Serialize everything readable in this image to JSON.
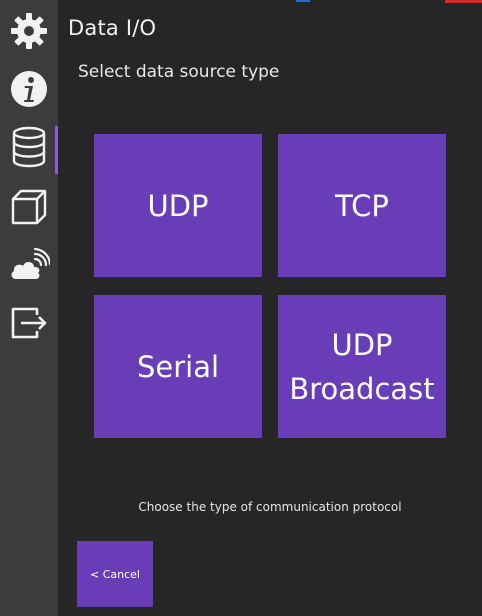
{
  "page": {
    "title": "Data I/O",
    "subtitle": "Select data source type",
    "hint": "Choose the type of communication protocol"
  },
  "sidebar": {
    "items": [
      {
        "icon": "gear-icon",
        "active": false
      },
      {
        "icon": "info-icon",
        "active": false
      },
      {
        "icon": "database-icon",
        "active": true
      },
      {
        "icon": "cube-icon",
        "active": false
      },
      {
        "icon": "cloud-signal-icon",
        "active": false
      },
      {
        "icon": "exit-icon",
        "active": false
      }
    ]
  },
  "tiles": {
    "udp": "UDP",
    "tcp": "TCP",
    "serial": "Serial",
    "udp_broadcast": "UDP\nBroadcast"
  },
  "cancel_label": "< Cancel",
  "colors": {
    "accent": "#6a3db8",
    "background": "#262626",
    "sidebar": "#3c3c3c"
  }
}
